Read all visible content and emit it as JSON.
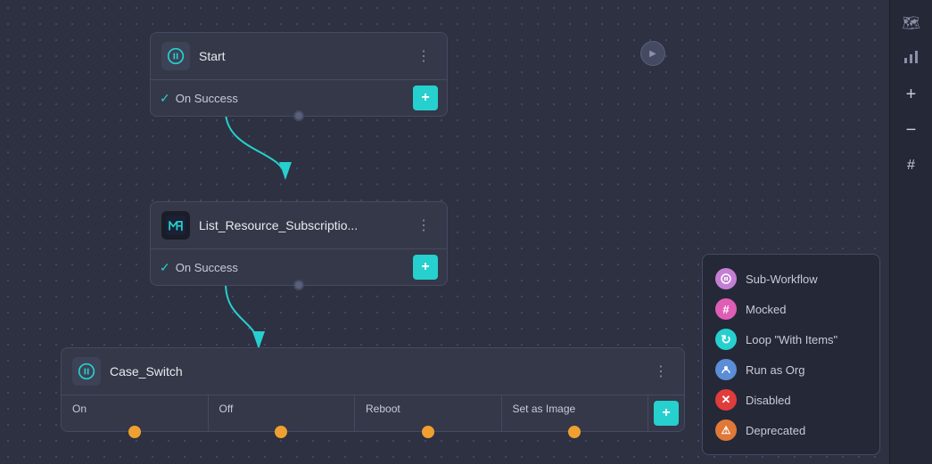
{
  "canvas": {
    "bg_color": "#2e3142",
    "dot_color": "#4a4f6a"
  },
  "toolbar": {
    "buttons": [
      {
        "id": "map",
        "icon": "🗺",
        "label": "map-icon"
      },
      {
        "id": "chart",
        "icon": "📈",
        "label": "chart-icon"
      },
      {
        "id": "plus",
        "icon": "+",
        "label": "zoom-in-icon"
      },
      {
        "id": "minus",
        "icon": "−",
        "label": "zoom-out-icon"
      },
      {
        "id": "hash",
        "icon": "#",
        "label": "grid-icon"
      }
    ]
  },
  "nodes": {
    "start": {
      "title": "Start",
      "icon": "⚙",
      "success_label": "On Success",
      "menu_icon": "⋮",
      "add_label": "+"
    },
    "list_resource": {
      "title": "List_Resource_Subscriptio...",
      "icon": "N",
      "success_label": "On Success",
      "menu_icon": "⋮",
      "add_label": "+"
    },
    "case_switch": {
      "title": "Case_Switch",
      "icon": "⚙",
      "menu_icon": "⋮",
      "add_label": "+",
      "columns": [
        "On",
        "Off",
        "Reboot",
        "Set as Image"
      ]
    }
  },
  "legend": {
    "items": [
      {
        "label": "Sub-Workflow",
        "color": "#c47fd4",
        "icon": "⚙"
      },
      {
        "label": "Mocked",
        "color": "#e05db5",
        "icon": "#"
      },
      {
        "label": "Loop \"With Items\"",
        "color": "#26d0ce",
        "icon": "↻"
      },
      {
        "label": "Run as Org",
        "color": "#5b8ed6",
        "icon": "👤"
      },
      {
        "label": "Disabled",
        "color": "#e03c3c",
        "icon": "✕"
      },
      {
        "label": "Deprecated",
        "color": "#e07838",
        "icon": "⚠"
      }
    ]
  }
}
